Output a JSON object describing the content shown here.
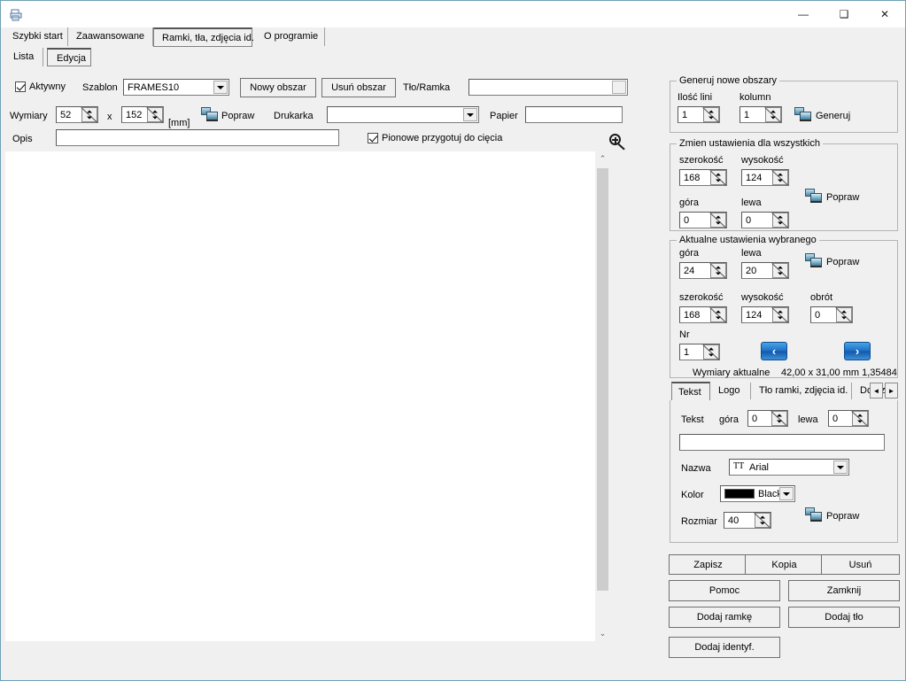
{
  "window": {
    "title": "",
    "icon": "printer-icon",
    "minimize_label": "—",
    "maximize_label": "❑",
    "close_label": "✕"
  },
  "main_tabs": [
    {
      "label": "Szybki start",
      "selected": false,
      "left": 0,
      "width": 72
    },
    {
      "label": "Zaawansowane",
      "selected": false,
      "width": 96
    },
    {
      "label": "Ramki, tła, zdjęcia id.",
      "selected": true,
      "width": 112
    },
    {
      "label": "O programie",
      "selected": false,
      "width": 78
    }
  ],
  "sub_tabs": [
    {
      "label": "Lista",
      "selected": false,
      "width": 44
    },
    {
      "label": "Edycja",
      "selected": true,
      "width": 50
    }
  ],
  "form": {
    "active_checkbox": {
      "label": "Aktywny",
      "checked": true
    },
    "template_label": "Szablon",
    "template_value": "FRAMES10",
    "new_area_button": "Nowy obszar",
    "delete_area_button": "Usuń obszar",
    "background_frame_label": "Tło/Ramka",
    "background_frame_value": "",
    "dimensions_label": "Wymiary",
    "dimensions_width": "52",
    "dimensions_separator": "x",
    "dimensions_height": "152",
    "dimensions_unit": "[mm]",
    "fix_button_label": "Popraw",
    "printer_label": "Drukarka",
    "printer_value": "",
    "paper_label": "Papier",
    "paper_value": "",
    "description_label": "Opis",
    "description_value": "",
    "vertical_cut_checkbox": {
      "label": "Pionowe przygotuj do cięcia",
      "checked": true
    },
    "zoom_icon": "magnifier-plus-icon"
  },
  "generate_group": {
    "caption": "Generuj nowe obszary",
    "lines_label": "Ilość lini",
    "lines_value": "1",
    "columns_label": "kolumn",
    "columns_value": "1",
    "generate_label": "Generuj"
  },
  "all_settings_group": {
    "caption": "Zmien ustawienia dla wszystkich",
    "width_label": "szerokość",
    "width_value": "168",
    "height_label": "wysokość",
    "height_value": "124",
    "top_label": "góra",
    "top_value": "0",
    "left_label": "lewa",
    "left_value": "0",
    "fix_label": "Popraw"
  },
  "current_settings_group": {
    "caption": "Aktualne ustawienia wybranego",
    "top_label": "góra",
    "top_value": "24",
    "left_label": "lewa",
    "left_value": "20",
    "fix_label": "Popraw",
    "width_label": "szerokość",
    "width_value": "168",
    "height_label": "wysokość",
    "height_value": "124",
    "rotation_label": "obrót",
    "rotation_value": "0",
    "number_label": "Nr",
    "number_value": "1",
    "prev_button": "‹",
    "next_button": "›",
    "current_dims_label": "Wymiary aktualne",
    "current_dims_value": "42,00 x 31,00 mm 1,35484"
  },
  "property_tabs": [
    {
      "label": "Tekst",
      "selected": true,
      "width": 44
    },
    {
      "label": "Logo",
      "selected": false,
      "width": 44
    },
    {
      "label": "Tło ramki, zdjęcia id.",
      "selected": false,
      "width": 112
    },
    {
      "label": "Dod.zd",
      "selected": false,
      "width": 40
    }
  ],
  "property_tab_scroll": {
    "left": "◄",
    "right": "►"
  },
  "text_panel": {
    "text_label": "Tekst",
    "top_label": "góra",
    "top_value": "0",
    "left_label": "lewa",
    "left_value": "0",
    "content_value": "",
    "font_name_label": "Nazwa",
    "font_name_value": "Arial",
    "font_glyph": "TT",
    "color_label": "Kolor",
    "color_value": "Black",
    "color_hex": "#000000",
    "size_label": "Rozmiar",
    "size_value": "40",
    "fix_label": "Popraw"
  },
  "action_buttons": {
    "save": "Zapisz",
    "copy": "Kopia",
    "delete": "Usuń",
    "help": "Pomoc",
    "close": "Zamknij",
    "add_frame": "Dodaj ramkę",
    "add_background": "Dodaj tło",
    "add_id": "Dodaj identyf."
  },
  "scrollbar": {
    "up_arrow": "⌃",
    "down_arrow": "⌄"
  },
  "colors": {
    "window_border": "#6fa0b5",
    "face": "#f0f0f0",
    "field": "#ffffff",
    "nav_blue": "#1f6fc4"
  }
}
